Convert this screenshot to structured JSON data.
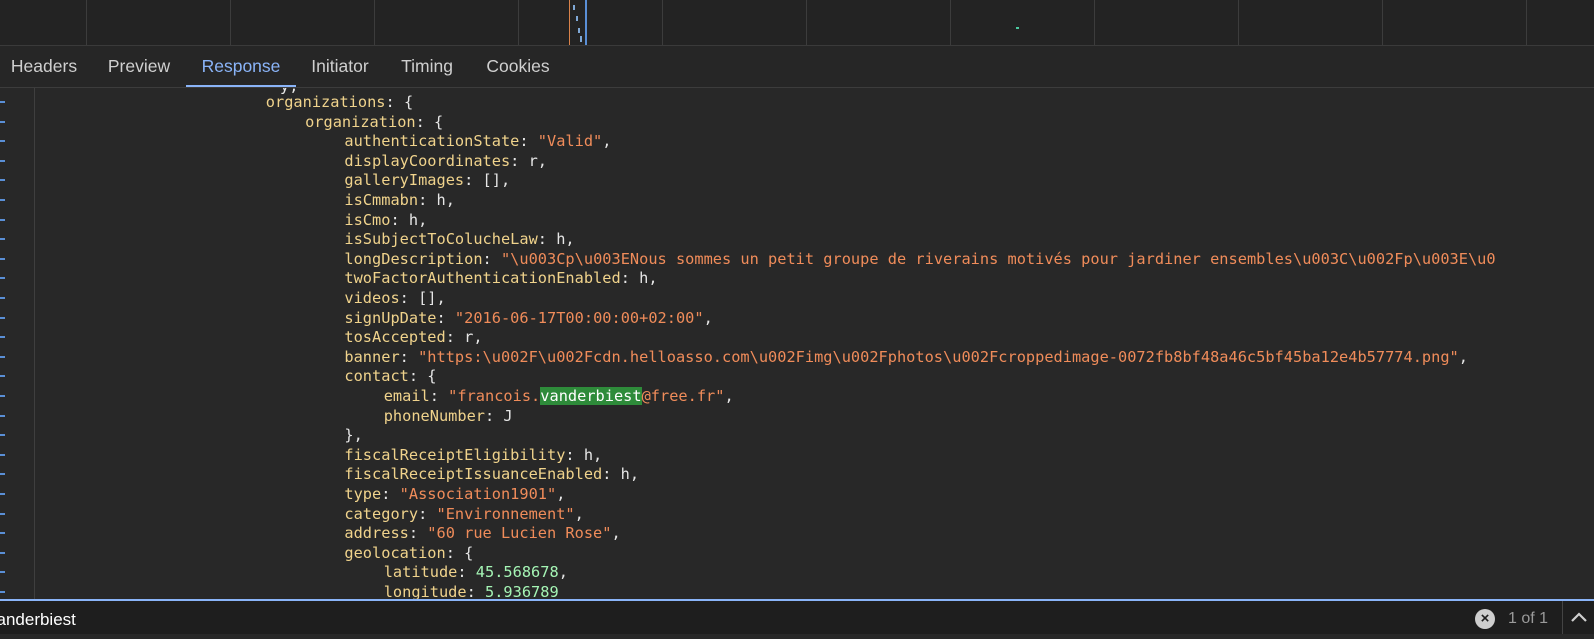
{
  "tabs": [
    {
      "label": "Headers"
    },
    {
      "label": "Preview"
    },
    {
      "label": "Response"
    },
    {
      "label": "Initiator"
    },
    {
      "label": "Timing"
    },
    {
      "label": "Cookies"
    }
  ],
  "active_tab": "Response",
  "code_lines": [
    {
      "indent": 6,
      "tokens": [
        {
          "t": "k",
          "v": "organizations"
        },
        {
          "t": "p",
          "v": ": {"
        }
      ]
    },
    {
      "indent": 7,
      "tokens": [
        {
          "t": "k",
          "v": "organization"
        },
        {
          "t": "p",
          "v": ": {"
        }
      ]
    },
    {
      "indent": 8,
      "tokens": [
        {
          "t": "k",
          "v": "authenticationState"
        },
        {
          "t": "p",
          "v": ": "
        },
        {
          "t": "s",
          "v": "\"Valid\""
        },
        {
          "t": "p",
          "v": ","
        }
      ]
    },
    {
      "indent": 8,
      "tokens": [
        {
          "t": "k",
          "v": "displayCoordinates"
        },
        {
          "t": "p",
          "v": ": r,"
        }
      ]
    },
    {
      "indent": 8,
      "tokens": [
        {
          "t": "k",
          "v": "galleryImages"
        },
        {
          "t": "p",
          "v": ": [],"
        }
      ]
    },
    {
      "indent": 8,
      "tokens": [
        {
          "t": "k",
          "v": "isCmmabn"
        },
        {
          "t": "p",
          "v": ": h,"
        }
      ]
    },
    {
      "indent": 8,
      "tokens": [
        {
          "t": "k",
          "v": "isCmo"
        },
        {
          "t": "p",
          "v": ": h,"
        }
      ]
    },
    {
      "indent": 8,
      "tokens": [
        {
          "t": "k",
          "v": "isSubjectToColucheLaw"
        },
        {
          "t": "p",
          "v": ": h,"
        }
      ]
    },
    {
      "indent": 8,
      "tokens": [
        {
          "t": "k",
          "v": "longDescription"
        },
        {
          "t": "p",
          "v": ": "
        },
        {
          "t": "s",
          "v": "\"\\u003Cp\\u003ENous sommes un petit groupe de riverains motivés pour jardiner ensembles\\u003C\\u002Fp\\u003E\\u0"
        }
      ]
    },
    {
      "indent": 8,
      "tokens": [
        {
          "t": "k",
          "v": "twoFactorAuthenticationEnabled"
        },
        {
          "t": "p",
          "v": ": h,"
        }
      ]
    },
    {
      "indent": 8,
      "tokens": [
        {
          "t": "k",
          "v": "videos"
        },
        {
          "t": "p",
          "v": ": [],"
        }
      ]
    },
    {
      "indent": 8,
      "tokens": [
        {
          "t": "k",
          "v": "signUpDate"
        },
        {
          "t": "p",
          "v": ": "
        },
        {
          "t": "s",
          "v": "\"2016-06-17T00:00:00+02:00\""
        },
        {
          "t": "p",
          "v": ","
        }
      ]
    },
    {
      "indent": 8,
      "tokens": [
        {
          "t": "k",
          "v": "tosAccepted"
        },
        {
          "t": "p",
          "v": ": r,"
        }
      ]
    },
    {
      "indent": 8,
      "tokens": [
        {
          "t": "k",
          "v": "banner"
        },
        {
          "t": "p",
          "v": ": "
        },
        {
          "t": "s",
          "v": "\"https:\\u002F\\u002Fcdn.helloasso.com\\u002Fimg\\u002Fphotos\\u002Fcroppedimage-0072fb8bf48a46c5bf45ba12e4b57774.png\""
        },
        {
          "t": "p",
          "v": ","
        }
      ]
    },
    {
      "indent": 8,
      "tokens": [
        {
          "t": "k",
          "v": "contact"
        },
        {
          "t": "p",
          "v": ": {"
        }
      ]
    },
    {
      "indent": 9,
      "tokens": [
        {
          "t": "k",
          "v": "email"
        },
        {
          "t": "p",
          "v": ": "
        },
        {
          "t": "s",
          "v": "\"francois."
        },
        {
          "t": "hl",
          "v": "vanderbiest"
        },
        {
          "t": "s",
          "v": "@free.fr\""
        },
        {
          "t": "p",
          "v": ","
        }
      ]
    },
    {
      "indent": 9,
      "tokens": [
        {
          "t": "k",
          "v": "phoneNumber"
        },
        {
          "t": "p",
          "v": ": J"
        }
      ]
    },
    {
      "indent": 8,
      "tokens": [
        {
          "t": "p",
          "v": "},"
        }
      ]
    },
    {
      "indent": 8,
      "tokens": [
        {
          "t": "k",
          "v": "fiscalReceiptEligibility"
        },
        {
          "t": "p",
          "v": ": h,"
        }
      ]
    },
    {
      "indent": 8,
      "tokens": [
        {
          "t": "k",
          "v": "fiscalReceiptIssuanceEnabled"
        },
        {
          "t": "p",
          "v": ": h,"
        }
      ]
    },
    {
      "indent": 8,
      "tokens": [
        {
          "t": "k",
          "v": "type"
        },
        {
          "t": "p",
          "v": ": "
        },
        {
          "t": "s",
          "v": "\"Association1901\""
        },
        {
          "t": "p",
          "v": ","
        }
      ]
    },
    {
      "indent": 8,
      "tokens": [
        {
          "t": "k",
          "v": "category"
        },
        {
          "t": "p",
          "v": ": "
        },
        {
          "t": "s",
          "v": "\"Environnement\""
        },
        {
          "t": "p",
          "v": ","
        }
      ]
    },
    {
      "indent": 8,
      "tokens": [
        {
          "t": "k",
          "v": "address"
        },
        {
          "t": "p",
          "v": ": "
        },
        {
          "t": "s",
          "v": "\"60 rue Lucien Rose\""
        },
        {
          "t": "p",
          "v": ","
        }
      ]
    },
    {
      "indent": 8,
      "tokens": [
        {
          "t": "k",
          "v": "geolocation"
        },
        {
          "t": "p",
          "v": ": {"
        }
      ]
    },
    {
      "indent": 9,
      "tokens": [
        {
          "t": "k",
          "v": "latitude"
        },
        {
          "t": "p",
          "v": ": "
        },
        {
          "t": "n",
          "v": "45.568678"
        },
        {
          "t": "p",
          "v": ","
        }
      ]
    },
    {
      "indent": 9,
      "tokens": [
        {
          "t": "k",
          "v": "longitude"
        },
        {
          "t": "p",
          "v": ": "
        },
        {
          "t": "n",
          "v": "5.936789"
        }
      ]
    }
  ],
  "search": {
    "query": "vanderbiest",
    "match_count": "1 of 1",
    "clear_icon": "clear-circle-icon",
    "prev_icon": "chevron-up-icon"
  },
  "colors": {
    "accent": "#8ab4f8",
    "key": "#f0d38c",
    "string": "#f08c5a",
    "number": "#a5f5b5",
    "match_highlight": "#2e8b3a"
  }
}
